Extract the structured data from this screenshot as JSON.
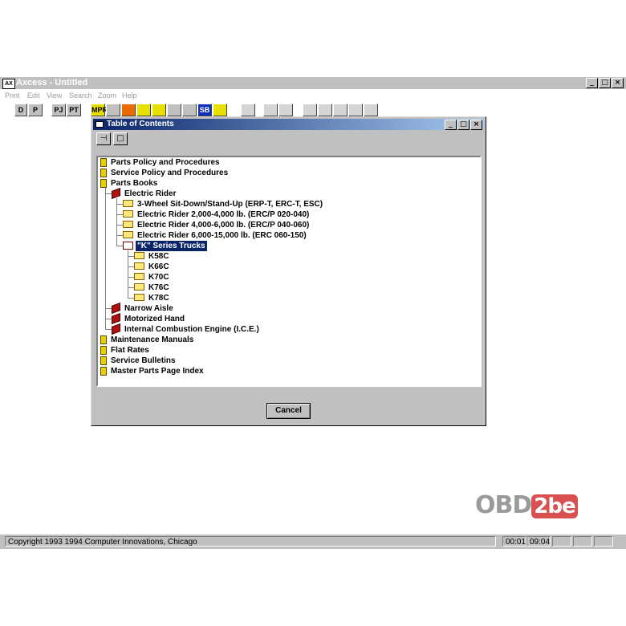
{
  "app": {
    "title": "Axcess - Untitled",
    "icon_text": "AX"
  },
  "caption_buttons": {
    "minimize": "_",
    "maximize": "□",
    "close": "×"
  },
  "menu": [
    "Print",
    "Edit",
    "View",
    "Search",
    "Zoom",
    "Help"
  ],
  "toolbar": {
    "buttons_left": [
      "D",
      "P",
      "PJ",
      "PT"
    ],
    "buttons_mid": [
      "MPR",
      "",
      "",
      "",
      "",
      "",
      "",
      "SB",
      ""
    ],
    "buttons_right_disabled": [
      "",
      "",
      "",
      "",
      "",
      "",
      "",
      ""
    ]
  },
  "dialog": {
    "title": "Table of Contents",
    "tools": [
      "⊣",
      "□"
    ],
    "cancel_label": "Cancel",
    "tree": [
      {
        "label": "Parts Policy and Procedures",
        "icon": "book-icon",
        "level": 0
      },
      {
        "label": "Service Policy and Procedures",
        "icon": "book-icon",
        "level": 0
      },
      {
        "label": "Parts Books",
        "icon": "book-icon",
        "level": 0
      },
      {
        "label": "Electric Rider",
        "icon": "open-book-icon",
        "level": 1
      },
      {
        "label": "3-Wheel Sit-Down/Stand-Up (ERP-T, ERC-T, ESC)",
        "icon": "folder-icon",
        "level": 2
      },
      {
        "label": "Electric Rider  2,000-4,000 lb. (ERC/P 020-040)",
        "icon": "folder-icon",
        "level": 2
      },
      {
        "label": "Electric Rider  4,000-6,000 lb. (ERC/P 040-060)",
        "icon": "folder-icon",
        "level": 2
      },
      {
        "label": "Electric Rider  6,000-15,000 lb. (ERC 060-150)",
        "icon": "folder-icon",
        "level": 2
      },
      {
        "label": "\"K\" Series Trucks",
        "icon": "open-folder-icon",
        "level": 2,
        "selected": true
      },
      {
        "label": "K58C",
        "icon": "folder-icon",
        "level": 3
      },
      {
        "label": "K66C",
        "icon": "folder-icon",
        "level": 3
      },
      {
        "label": "K70C",
        "icon": "folder-icon",
        "level": 3
      },
      {
        "label": "K76C",
        "icon": "folder-icon",
        "level": 3
      },
      {
        "label": "K78C",
        "icon": "folder-icon",
        "level": 3
      },
      {
        "label": "Narrow Aisle",
        "icon": "red-book-icon",
        "level": 1
      },
      {
        "label": "Motorized Hand",
        "icon": "red-book-icon",
        "level": 1
      },
      {
        "label": "Internal Combustion Engine (I.C.E.)",
        "icon": "red-book-icon",
        "level": 1
      },
      {
        "label": "Maintenance Manuals",
        "icon": "book-icon",
        "level": 0
      },
      {
        "label": "Flat Rates",
        "icon": "book-icon",
        "level": 0
      },
      {
        "label": "Service Bulletins",
        "icon": "book-icon",
        "level": 0
      },
      {
        "label": "Master Parts Page Index",
        "icon": "book-icon",
        "level": 0
      }
    ]
  },
  "status": {
    "copyright": "Copyright 1993 1994 Computer Innovations, Chicago",
    "time1": "00:01",
    "time2": "09:04"
  },
  "watermark": {
    "left": "OBD",
    "right": "2be"
  },
  "colors": {
    "selection": "#0a246a",
    "face": "#c0c0c0"
  }
}
